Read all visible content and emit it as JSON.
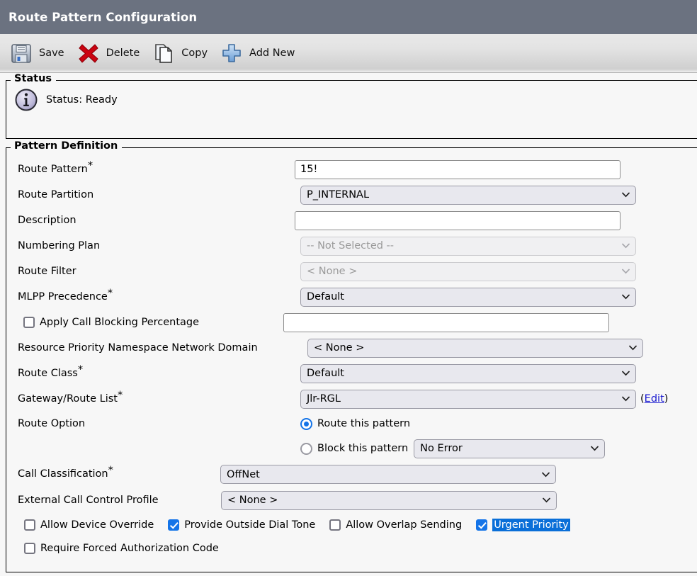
{
  "window": {
    "title": "Route Pattern Configuration",
    "header_bg": "#6b7280"
  },
  "toolbar": {
    "items": [
      {
        "label": "Save",
        "icon": "floppy-disk-icon"
      },
      {
        "label": "Delete",
        "icon": "red-x-icon"
      },
      {
        "label": "Copy",
        "icon": "copy-pages-icon"
      },
      {
        "label": "Add New",
        "icon": "blue-plus-icon"
      }
    ]
  },
  "status": {
    "legend": "Status",
    "icon": "info-circle-icon",
    "text": "Status: Ready"
  },
  "pattern": {
    "legend": "Pattern Definition",
    "fields": {
      "route_pattern": {
        "label": "Route Pattern",
        "required": "*",
        "value": "15!"
      },
      "route_partition": {
        "label": "Route Partition",
        "value": "P_INTERNAL"
      },
      "description": {
        "label": "Description",
        "value": ""
      },
      "numbering_plan": {
        "label": "Numbering Plan",
        "value": "-- Not Selected --"
      },
      "route_filter": {
        "label": "Route Filter",
        "value": "< None >"
      },
      "mlpp_precedence": {
        "label": "MLPP Precedence",
        "required": "*",
        "value": "Default"
      },
      "apply_call_blocking": {
        "label": "Apply Call Blocking Percentage",
        "checked": false,
        "value": ""
      },
      "rpnnd": {
        "label": "Resource Priority Namespace Network Domain",
        "value": "< None >"
      },
      "route_class": {
        "label": "Route Class",
        "required": "*",
        "value": "Default"
      },
      "gateway_route_list": {
        "label": "Gateway/Route List",
        "required": "*",
        "value": "Jlr-RGL",
        "edit_label": "Edit"
      },
      "route_option": {
        "label": "Route Option",
        "route_this_pattern": "Route this pattern",
        "block_this_pattern": "Block this pattern",
        "selected": "route",
        "block_reason": "No Error"
      },
      "call_classification": {
        "label": "Call Classification",
        "required": "*",
        "value": "OffNet"
      },
      "external_ccp": {
        "label": "External Call Control Profile",
        "value": "< None >"
      }
    },
    "checkboxes": [
      {
        "label": "Allow Device Override",
        "checked": false,
        "highlighted": false
      },
      {
        "label": "Provide Outside Dial Tone",
        "checked": true,
        "highlighted": false
      },
      {
        "label": "Allow Overlap Sending",
        "checked": false,
        "highlighted": false
      },
      {
        "label": "Urgent Priority",
        "checked": true,
        "highlighted": true
      }
    ],
    "checkbox_row2": [
      {
        "label": "Require Forced Authorization Code",
        "checked": false,
        "highlighted": false
      }
    ]
  }
}
